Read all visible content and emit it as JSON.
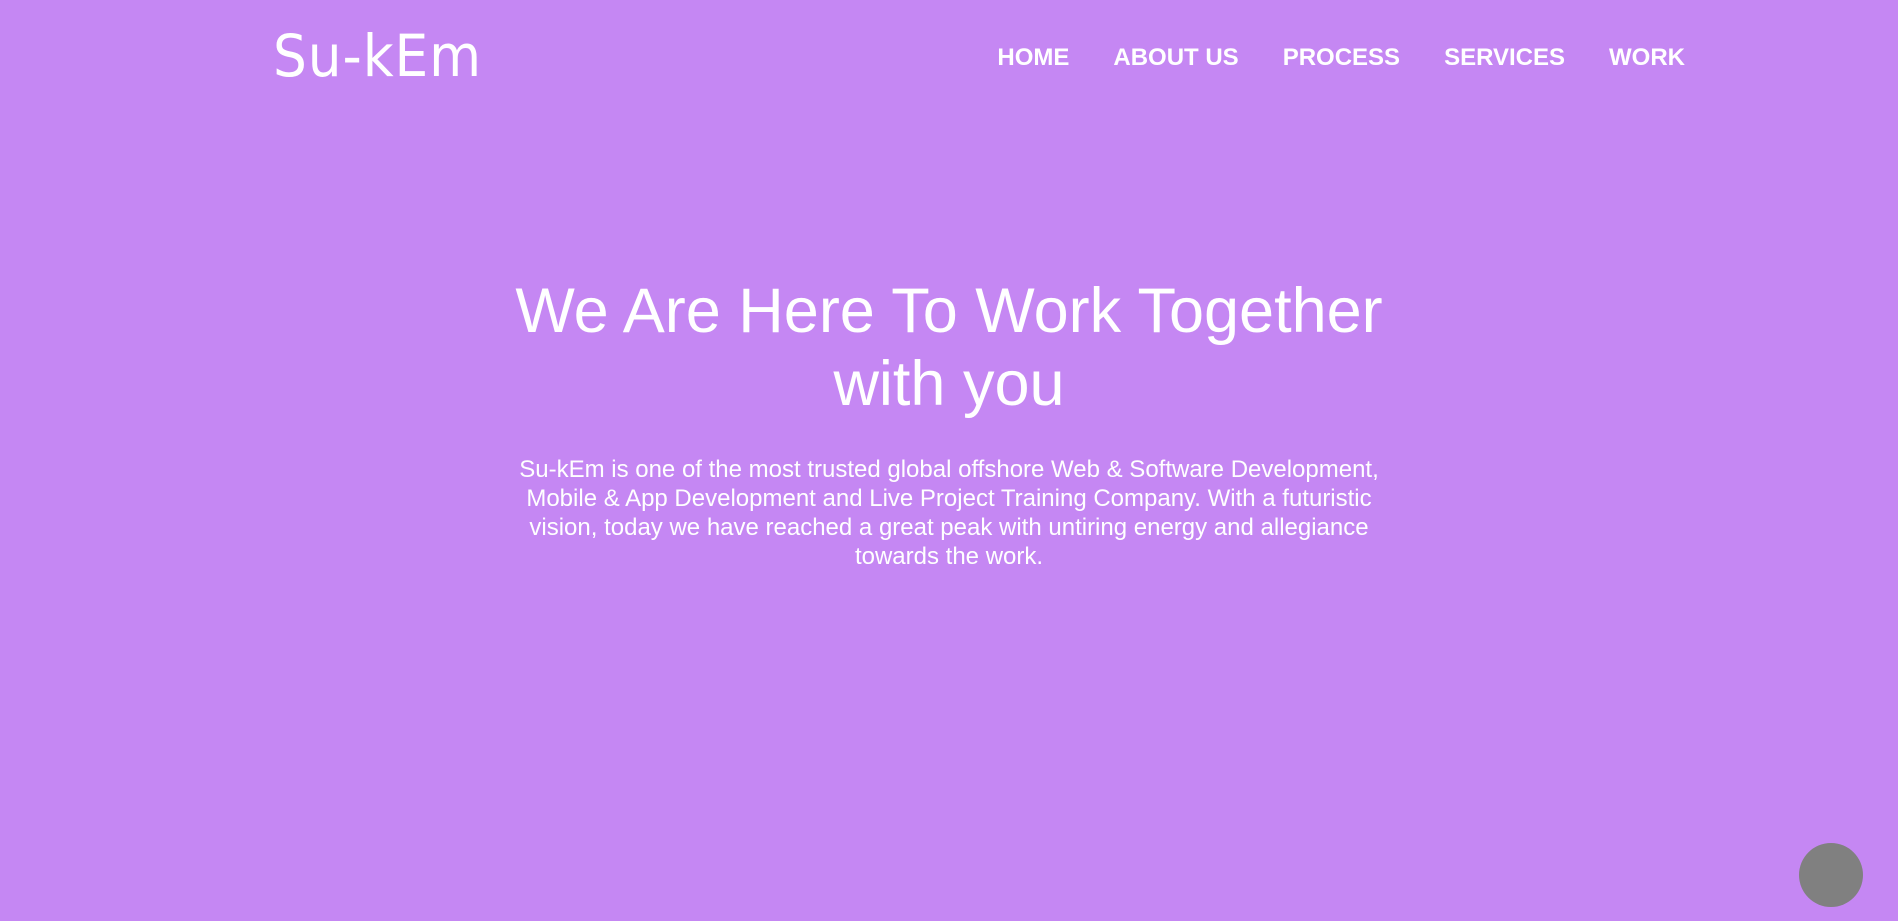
{
  "header": {
    "logo_text": "Su-kEm",
    "nav": [
      {
        "label": "HOME"
      },
      {
        "label": "ABOUT US"
      },
      {
        "label": "PROCESS"
      },
      {
        "label": "SERVICES"
      },
      {
        "label": "WORK"
      }
    ]
  },
  "hero": {
    "title": "We Are Here To Work Together with you",
    "description": "Su-kEm is one of the most trusted global offshore Web & Software Development, Mobile & App Development and Live Project Training Company. With a futuristic vision, today we have reached a great peak with untiring energy and allegiance towards the work."
  },
  "colors": {
    "background": "#c587f3",
    "text": "#ffffff",
    "fab": "#808080"
  }
}
